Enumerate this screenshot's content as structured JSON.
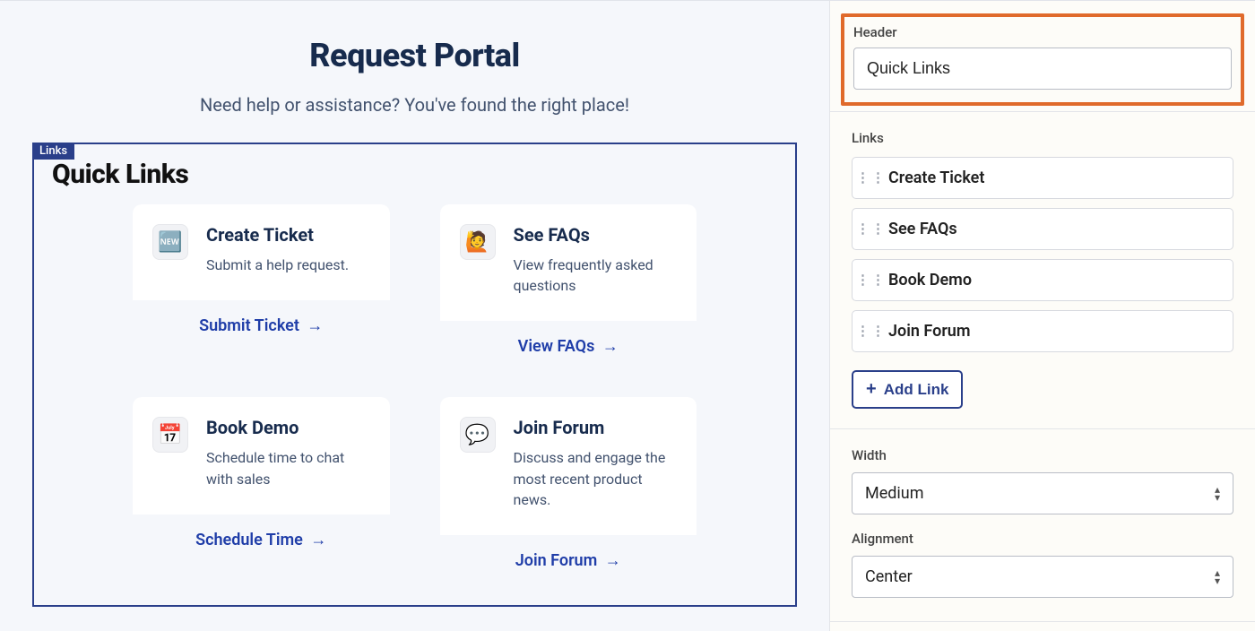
{
  "portal": {
    "title": "Request Portal",
    "subtitle": "Need help or assistance? You've found the right place!"
  },
  "block": {
    "tag": "Links",
    "heading": "Quick Links",
    "cards": [
      {
        "icon": "🆕",
        "title": "Create Ticket",
        "desc": "Submit a help request.",
        "action": "Submit Ticket"
      },
      {
        "icon": "🙋",
        "title": "See FAQs",
        "desc": "View frequently asked questions",
        "action": "View FAQs"
      },
      {
        "icon": "📅",
        "title": "Book Demo",
        "desc": "Schedule time to chat with sales",
        "action": "Schedule Time"
      },
      {
        "icon": "💬",
        "title": "Join Forum",
        "desc": "Discuss and engage the most recent product news.",
        "action": "Join Forum"
      }
    ]
  },
  "sidebar": {
    "header_label": "Header",
    "header_value": "Quick Links",
    "links_label": "Links",
    "link_items": [
      {
        "label": "Create Ticket"
      },
      {
        "label": "See FAQs"
      },
      {
        "label": "Book Demo"
      },
      {
        "label": "Join Forum"
      }
    ],
    "add_link_label": "Add Link",
    "width_label": "Width",
    "width_value": "Medium",
    "alignment_label": "Alignment",
    "alignment_value": "Center"
  }
}
